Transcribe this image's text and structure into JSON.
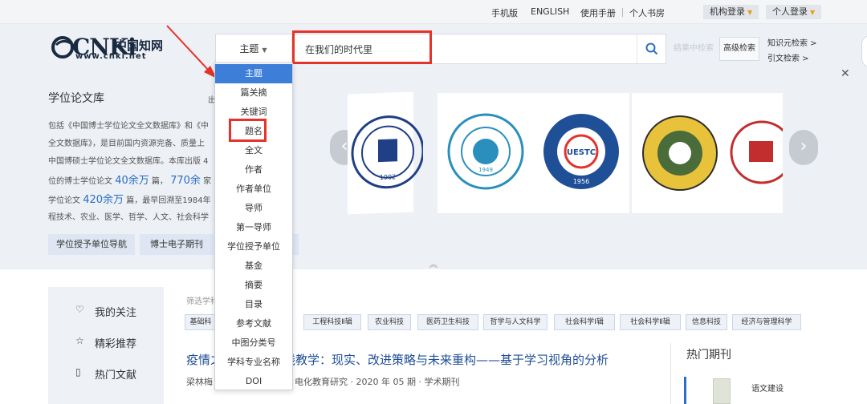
{
  "topbar": {
    "links": [
      "手机版",
      "ENGLISH",
      "使用手册",
      "个人书房"
    ],
    "institution_login": "机构登录",
    "personal_login": "个人登录"
  },
  "logo": {
    "brand": "CNKi",
    "cn": "中国知网",
    "url": "www.cnki.net"
  },
  "search": {
    "type_label": "主题",
    "query": "在我们的时代里",
    "ghost_button": "结果中检索",
    "advanced_button": "高级检索",
    "knowledge_search": "知识元检索 >",
    "citation_search": "引文检索 >"
  },
  "dropdown": {
    "items": [
      "主题",
      "篇关摘",
      "关键词",
      "题名",
      "全文",
      "作者",
      "作者单位",
      "导师",
      "第一导师",
      "学位授予单位",
      "基金",
      "摘要",
      "目录",
      "参考文献",
      "中图分类号",
      "学科专业名称",
      "DOI"
    ],
    "active_index": 0,
    "highlighted_index": 3
  },
  "library": {
    "title": "学位论文库",
    "title_suffix": "出",
    "desc": [
      "包括《中国博士学位论文全文数据库》和《中",
      "全文数据库》，是目前国内资源完备、质量上",
      "中国博硕士学位论文全文数据库。本库出版 4",
      "位的博士学位论文 ",
      "学位论文 ",
      "程技术、农业、医学、哲学、人文、社会科学"
    ],
    "desc_line4": {
      "num1": "40余万",
      "mid": " 篇， ",
      "num2": "770余",
      "tail": " 家"
    },
    "desc_line5": {
      "num": "420余万",
      "tail": " 篇，最早回溯至1984年"
    },
    "buttons": [
      "学位授予单位导航",
      "博士电子期刊",
      "硕"
    ]
  },
  "carousel": {
    "universities": [
      "Beijing Normal University",
      "Dalian University of Technology",
      "UESTC",
      "Southeast University",
      "Lanzhou University"
    ],
    "years": [
      "1902",
      "1949",
      "1956",
      "",
      ""
    ]
  },
  "left_panel": {
    "items": [
      "我的关注",
      "精彩推荐",
      "热门文献"
    ]
  },
  "filters": {
    "label": "筛选学科",
    "tags": [
      "基础科",
      "工程科技Ⅱ辑",
      "农业科技",
      "医药卫生科技",
      "哲学与人文科学",
      "社会科学Ⅰ辑",
      "社会科学Ⅱ辑",
      "信息科技",
      "经济与管理科学"
    ]
  },
  "article": {
    "title_a": "疫情之",
    "title_b": "线教学：现实、改进策略与未来重构——基于学习视角的分析",
    "author": "梁林梅",
    "source": "电化教育研究",
    "issue": "2020 年 05 期",
    "type": "学术期刊",
    "dot": "·"
  },
  "hot": {
    "title": "热门期刊",
    "item": "语文建设"
  },
  "colors": {
    "accent": "#2a6ec5",
    "highlight_red": "#e5332a",
    "active_blue": "#3d7fd8",
    "band": "#edf0f5"
  }
}
